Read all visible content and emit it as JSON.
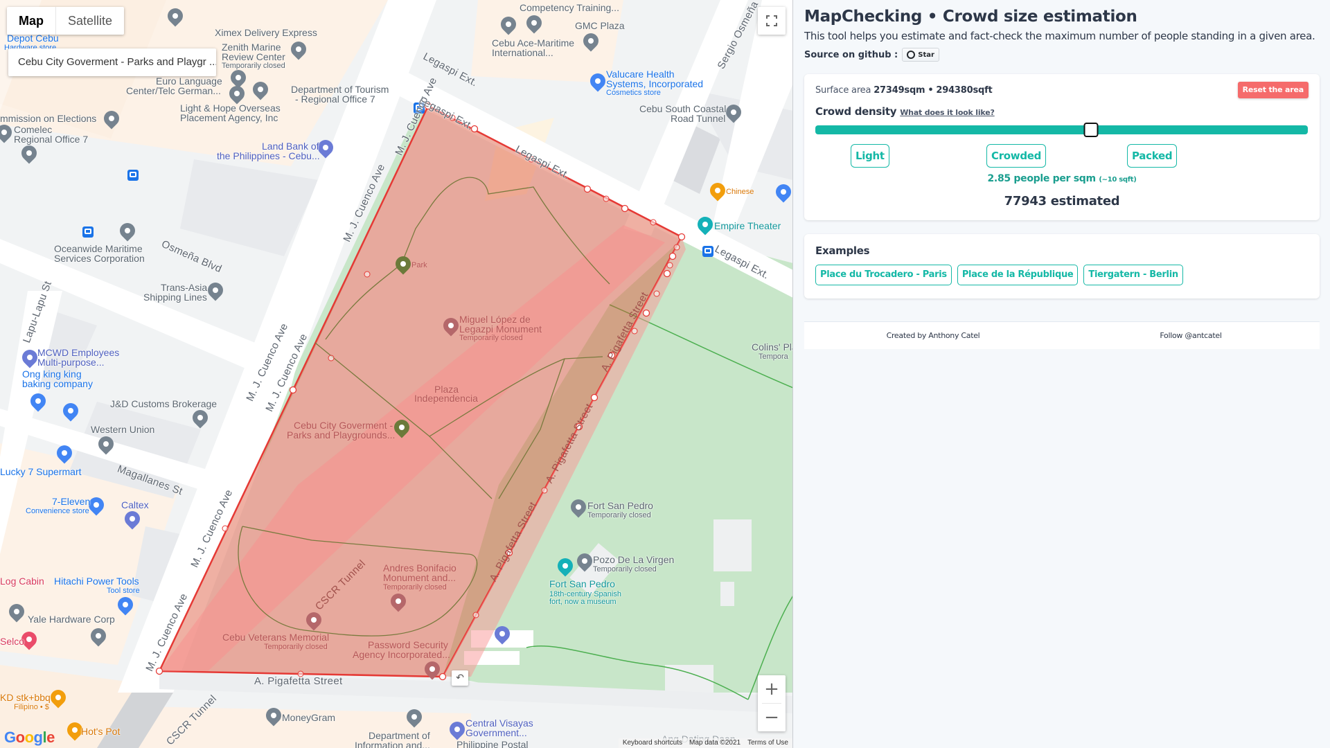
{
  "map": {
    "type_controls": [
      {
        "label": "Map",
        "active": true
      },
      {
        "label": "Satellite",
        "active": false
      }
    ],
    "place_card": "Cebu City Goverment - Parks and Playgr ...",
    "zoom_in": "+",
    "zoom_out": "−",
    "undo_icon": "↶",
    "attribution": {
      "shortcuts": "Keyboard shortcuts",
      "data": "Map data ©2021",
      "terms": "Terms of Use"
    },
    "logo": [
      "G",
      "o",
      "o",
      "g",
      "l",
      "e"
    ],
    "polygon_color": "#e53935",
    "labels": [
      {
        "text": "Ximex Delivery Express",
        "style": ""
      },
      {
        "text": "Zenith Marine",
        "sub": "",
        "style": ""
      },
      {
        "text": "Review Center",
        "style": ""
      },
      {
        "text": "Temporarily closed",
        "style": ""
      },
      {
        "text": "Depot Cebu",
        "style": "blue"
      },
      {
        "text": "Hardware store",
        "style": "blue"
      },
      {
        "text": "Euro Language",
        "style": ""
      },
      {
        "text": "Center/Telc German...",
        "style": ""
      },
      {
        "text": "Department of Tourism",
        "style": ""
      },
      {
        "text": "- Regional Office 7",
        "style": ""
      },
      {
        "text": "Light & Hope Overseas",
        "style": ""
      },
      {
        "text": "Placement Agency, Inc",
        "style": ""
      },
      {
        "text": "mmission on Elections",
        "style": ""
      },
      {
        "text": "Comelec",
        "style": ""
      },
      {
        "text": "Regional Office 7",
        "style": ""
      },
      {
        "text": "Land Bank of",
        "style": "purple"
      },
      {
        "text": "the Philippines -  Cebu...",
        "style": "purple"
      },
      {
        "text": "Oceanwide Maritime",
        "style": ""
      },
      {
        "text": "Services Corporation",
        "style": ""
      },
      {
        "text": "Trans-Asia",
        "style": ""
      },
      {
        "text": "Shipping Lines",
        "style": ""
      },
      {
        "text": "MCWD Employees",
        "style": "purple"
      },
      {
        "text": "Multi-purpose...",
        "style": "purple"
      },
      {
        "text": "Ong king king",
        "style": "blue"
      },
      {
        "text": "baking company",
        "style": "blue"
      },
      {
        "text": "J&D Customs Brokerage",
        "style": ""
      },
      {
        "text": "Western Union",
        "style": ""
      },
      {
        "text": "Lucky 7 Supermart",
        "style": "blue"
      },
      {
        "text": "7-Eleven",
        "style": "blue"
      },
      {
        "text": "Convenience store",
        "style": "blue"
      },
      {
        "text": "Caltex",
        "style": "purple"
      },
      {
        "text": "Log Cabin",
        "style": "red"
      },
      {
        "text": "Hitachi Power Tools",
        "style": "blue"
      },
      {
        "text": "Tool store",
        "style": "blue"
      },
      {
        "text": "Yale Hardware Corp",
        "style": ""
      },
      {
        "text": "Selco",
        "style": "red"
      },
      {
        "text": "KD stk+bbq",
        "style": "orange"
      },
      {
        "text": "Filipino • $",
        "style": "orange"
      },
      {
        "text": "Hot's Pot",
        "style": "orange"
      },
      {
        "text": "MoneyGram",
        "style": ""
      },
      {
        "text": "Department of",
        "style": ""
      },
      {
        "text": "Information and...",
        "style": ""
      },
      {
        "text": "Central Visayas",
        "style": "purple"
      },
      {
        "text": "Government...",
        "style": "purple"
      },
      {
        "text": "Philippine Postal",
        "style": ""
      },
      {
        "text": "Ang Dating Daan",
        "style": ""
      },
      {
        "text": "Competency Training...",
        "style": ""
      },
      {
        "text": "Cebu Ace-Maritime",
        "style": ""
      },
      {
        "text": "International...",
        "style": ""
      },
      {
        "text": "GMC Plaza",
        "style": ""
      },
      {
        "text": "Valucare Health",
        "style": "blue"
      },
      {
        "text": "Systems, Incorporated",
        "style": "blue"
      },
      {
        "text": "Cosmetics store",
        "style": "blue"
      },
      {
        "text": "Cebu South Coastal",
        "style": ""
      },
      {
        "text": "Road Tunnel",
        "style": ""
      },
      {
        "text": "Chinese",
        "style": "orange"
      },
      {
        "text": "Empire Theater",
        "style": "teal"
      },
      {
        "text": "Colins' Pla",
        "style": ""
      },
      {
        "text": "Tempora",
        "style": ""
      },
      {
        "text": "Park",
        "style": "in-poly"
      },
      {
        "text": "Miguel López de",
        "style": "in-poly"
      },
      {
        "text": "Legazpi Monument",
        "style": "in-poly"
      },
      {
        "text": "Temporarily closed",
        "style": "in-poly"
      },
      {
        "text": "Plaza",
        "style": "in-poly"
      },
      {
        "text": "Independencia",
        "style": "in-poly"
      },
      {
        "text": "Cebu City Goverment -",
        "style": "in-poly"
      },
      {
        "text": "Parks and Playgrounds...",
        "style": "in-poly"
      },
      {
        "text": "Andres Bonifacio",
        "style": "in-poly"
      },
      {
        "text": "Monument and...",
        "style": "in-poly"
      },
      {
        "text": "Temporarily closed",
        "style": "in-poly"
      },
      {
        "text": "Cebu Veterans Memorial",
        "style": "in-poly"
      },
      {
        "text": "Temporarily closed",
        "style": "in-poly"
      },
      {
        "text": "Password Security",
        "style": "in-poly"
      },
      {
        "text": "Agency Incorporated...",
        "style": "in-poly"
      },
      {
        "text": "Fort San Pedro",
        "style": ""
      },
      {
        "text": "Temporarily closed",
        "style": ""
      },
      {
        "text": "Pozo De La Virgen",
        "style": ""
      },
      {
        "text": "Temporarily closed",
        "style": ""
      },
      {
        "text": "Fort San Pedro",
        "style": "teal"
      },
      {
        "text": "18th-century Spanish",
        "style": "teal"
      },
      {
        "text": "fort, now a museum",
        "style": "teal"
      }
    ],
    "streets": {
      "legaspi": "Legaspi Ext.",
      "cuenco": "M. J. Cuenco Ave",
      "osmena_blvd": "Osmeña Blvd",
      "lapu_lapu": "Lapu-Lapu St",
      "magallanes": "Magallanes St",
      "pigafetta": "A. Pigafetta Street",
      "cscr": "CSCR Tunnel",
      "sergio": "Sergio Osmeña",
      "cs": "CS"
    }
  },
  "sidebar": {
    "title": "MapChecking • Crowd size estimation",
    "subtitle": "This tool helps you estimate and fact-check the maximum number of people standing in a given area.",
    "github_label": "Source on github :",
    "star_label": "Star",
    "surface_label": "Surface area",
    "surface_sqm": "27349sqm",
    "surface_sep": "•",
    "surface_sqft": "294380sqft",
    "reset_label": "Reset the area",
    "density_label": "Crowd density",
    "density_link": "What does it look like?",
    "density_slider_fraction": 0.56,
    "presets": [
      "Light",
      "Crowded",
      "Packed"
    ],
    "density_value": "2.85 people per sqm",
    "density_sqft": "(~10 sqft)",
    "estimate": "77943 estimated",
    "accent_color": "#14b8a6",
    "reset_color": "#f56b6b",
    "examples_title": "Examples",
    "examples": [
      "Place du Trocadero - Paris",
      "Place de la République",
      "Tiergatern - Berlin"
    ],
    "footer": {
      "created_by": "Created by Anthony Catel",
      "follow": "Follow @antcatel"
    }
  }
}
